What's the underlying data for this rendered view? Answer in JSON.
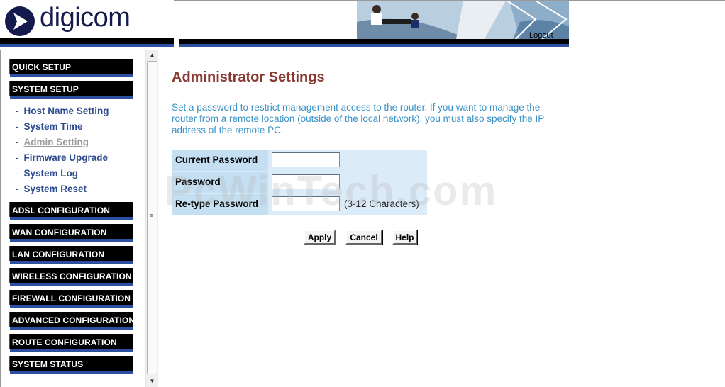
{
  "brand": {
    "logo_text": "digicom",
    "logo_color": "#141a4c"
  },
  "header": {
    "logout_label": "Logout"
  },
  "sidebar": {
    "sections": [
      {
        "label": "QUICK SETUP"
      },
      {
        "label": "SYSTEM SETUP"
      },
      {
        "label": "ADSL CONFIGURATION"
      },
      {
        "label": "WAN CONFIGURATION"
      },
      {
        "label": "LAN CONFIGURATION"
      },
      {
        "label": "WIRELESS CONFIGURATION"
      },
      {
        "label": "FIREWALL CONFIGURATION"
      },
      {
        "label": "ADVANCED CONFIGURATION"
      },
      {
        "label": "ROUTE CONFIGURATION"
      },
      {
        "label": "SYSTEM STATUS"
      }
    ],
    "sub_items": [
      {
        "label": "Host Name Setting",
        "state": "normal"
      },
      {
        "label": "System Time",
        "state": "normal"
      },
      {
        "label": "Admin Setting",
        "state": "current"
      },
      {
        "label": "Firmware Upgrade",
        "state": "normal"
      },
      {
        "label": "System Log",
        "state": "normal"
      },
      {
        "label": "System Reset",
        "state": "normal"
      }
    ],
    "dash": "-",
    "scroll_grip": "≡"
  },
  "main": {
    "title": "Administrator Settings",
    "description": "Set a password to restrict management access to the router. If you want to manage the router from a remote location (outside of the local network), you must also specify the IP address of the remote PC.",
    "form": {
      "current_password_label": "Current Password",
      "current_password_value": "",
      "password_label": "Password",
      "password_value": "",
      "retype_password_label": "Re-type Password",
      "retype_password_value": "",
      "retype_hint": "(3-12 Characters)"
    },
    "buttons": {
      "apply": "Apply",
      "cancel": "Cancel",
      "help": "Help"
    },
    "watermark": "PcWinTech.com"
  },
  "colors": {
    "title": "#8a3a33",
    "description": "#3b92c6",
    "nav_link": "#2c4a8e",
    "nav_bar": "#000000",
    "nav_accent": "#2c4fa0",
    "form_bg": "#dcebf8",
    "label_bg": "#c5dff2"
  }
}
